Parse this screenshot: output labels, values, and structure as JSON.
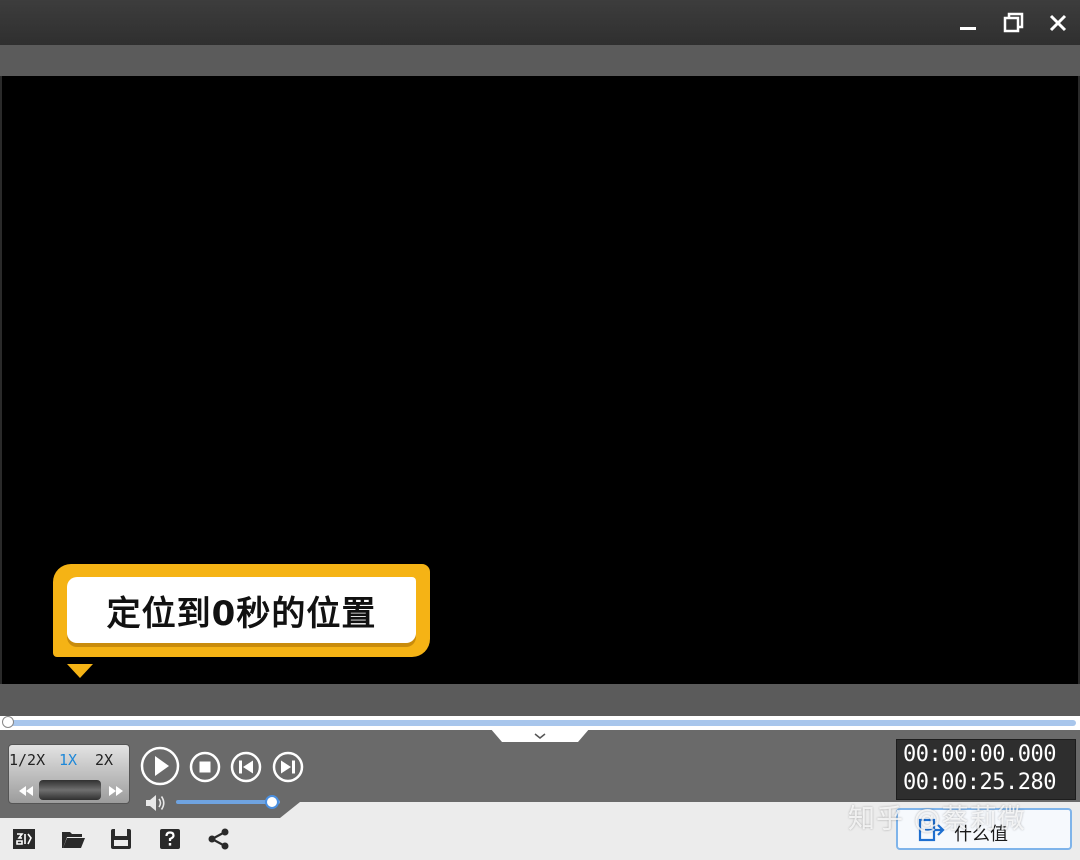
{
  "window": {
    "controls": [
      {
        "name": "minimize-icon"
      },
      {
        "name": "restore-icon"
      },
      {
        "name": "close-icon"
      }
    ]
  },
  "tooltip": {
    "text": "定位到0秒的位置",
    "color": "#f5b315"
  },
  "seekbar": {
    "position_fraction": 0.0,
    "color": "#a8c6ec"
  },
  "speed": {
    "options": [
      "1/2X",
      "1X",
      "2X"
    ],
    "selected": "1X",
    "accent": "#1e88d8"
  },
  "playback": {
    "buttons": [
      "play-icon",
      "stop-icon",
      "previous-frame-icon",
      "next-frame-icon"
    ]
  },
  "volume": {
    "level_fraction": 0.92,
    "color": "#4a8fe0"
  },
  "time": {
    "current": "00:00:00.000",
    "total": "00:00:25.280"
  },
  "toolbar": {
    "icons": [
      "clip-info-icon",
      "open-folder-icon",
      "save-icon",
      "help-icon",
      "share-icon"
    ],
    "export_label": "什么值"
  },
  "watermark": {
    "text": "知乎 @蔡莉微"
  }
}
